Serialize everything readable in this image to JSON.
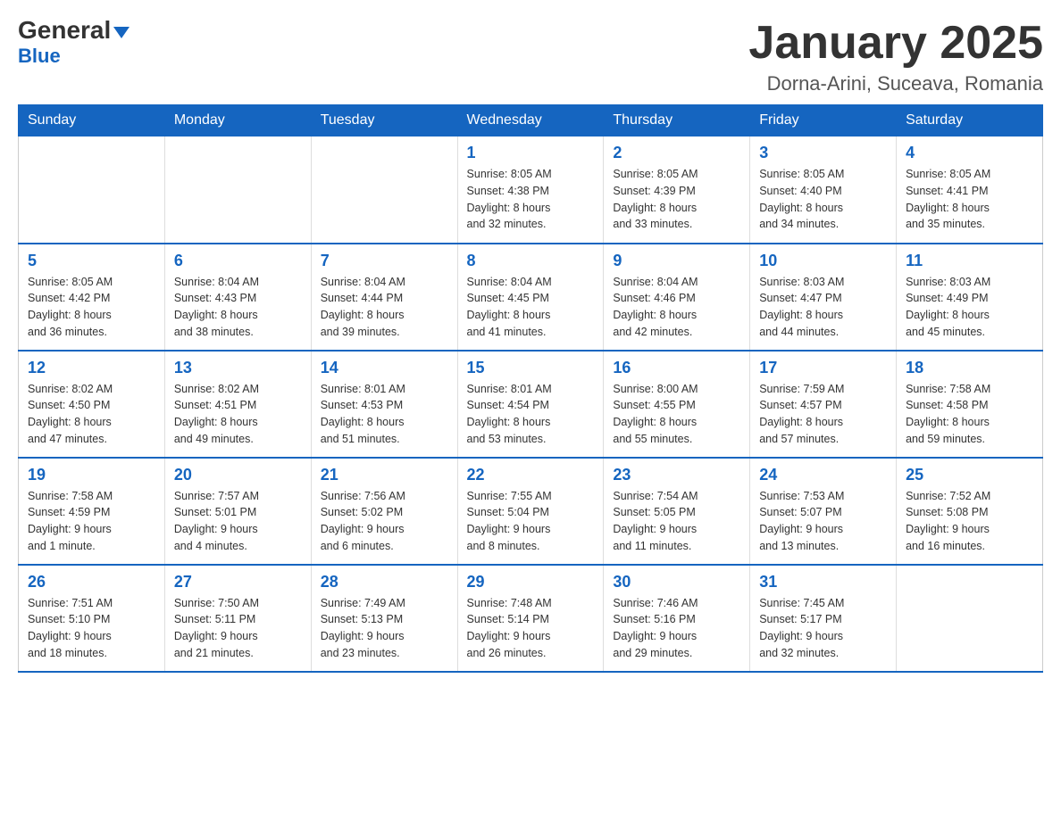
{
  "logo": {
    "text1": "General",
    "text2": "Blue"
  },
  "title": "January 2025",
  "location": "Dorna-Arini, Suceava, Romania",
  "weekdays": [
    "Sunday",
    "Monday",
    "Tuesday",
    "Wednesday",
    "Thursday",
    "Friday",
    "Saturday"
  ],
  "weeks": [
    [
      {
        "day": "",
        "info": ""
      },
      {
        "day": "",
        "info": ""
      },
      {
        "day": "",
        "info": ""
      },
      {
        "day": "1",
        "info": "Sunrise: 8:05 AM\nSunset: 4:38 PM\nDaylight: 8 hours\nand 32 minutes."
      },
      {
        "day": "2",
        "info": "Sunrise: 8:05 AM\nSunset: 4:39 PM\nDaylight: 8 hours\nand 33 minutes."
      },
      {
        "day": "3",
        "info": "Sunrise: 8:05 AM\nSunset: 4:40 PM\nDaylight: 8 hours\nand 34 minutes."
      },
      {
        "day": "4",
        "info": "Sunrise: 8:05 AM\nSunset: 4:41 PM\nDaylight: 8 hours\nand 35 minutes."
      }
    ],
    [
      {
        "day": "5",
        "info": "Sunrise: 8:05 AM\nSunset: 4:42 PM\nDaylight: 8 hours\nand 36 minutes."
      },
      {
        "day": "6",
        "info": "Sunrise: 8:04 AM\nSunset: 4:43 PM\nDaylight: 8 hours\nand 38 minutes."
      },
      {
        "day": "7",
        "info": "Sunrise: 8:04 AM\nSunset: 4:44 PM\nDaylight: 8 hours\nand 39 minutes."
      },
      {
        "day": "8",
        "info": "Sunrise: 8:04 AM\nSunset: 4:45 PM\nDaylight: 8 hours\nand 41 minutes."
      },
      {
        "day": "9",
        "info": "Sunrise: 8:04 AM\nSunset: 4:46 PM\nDaylight: 8 hours\nand 42 minutes."
      },
      {
        "day": "10",
        "info": "Sunrise: 8:03 AM\nSunset: 4:47 PM\nDaylight: 8 hours\nand 44 minutes."
      },
      {
        "day": "11",
        "info": "Sunrise: 8:03 AM\nSunset: 4:49 PM\nDaylight: 8 hours\nand 45 minutes."
      }
    ],
    [
      {
        "day": "12",
        "info": "Sunrise: 8:02 AM\nSunset: 4:50 PM\nDaylight: 8 hours\nand 47 minutes."
      },
      {
        "day": "13",
        "info": "Sunrise: 8:02 AM\nSunset: 4:51 PM\nDaylight: 8 hours\nand 49 minutes."
      },
      {
        "day": "14",
        "info": "Sunrise: 8:01 AM\nSunset: 4:53 PM\nDaylight: 8 hours\nand 51 minutes."
      },
      {
        "day": "15",
        "info": "Sunrise: 8:01 AM\nSunset: 4:54 PM\nDaylight: 8 hours\nand 53 minutes."
      },
      {
        "day": "16",
        "info": "Sunrise: 8:00 AM\nSunset: 4:55 PM\nDaylight: 8 hours\nand 55 minutes."
      },
      {
        "day": "17",
        "info": "Sunrise: 7:59 AM\nSunset: 4:57 PM\nDaylight: 8 hours\nand 57 minutes."
      },
      {
        "day": "18",
        "info": "Sunrise: 7:58 AM\nSunset: 4:58 PM\nDaylight: 8 hours\nand 59 minutes."
      }
    ],
    [
      {
        "day": "19",
        "info": "Sunrise: 7:58 AM\nSunset: 4:59 PM\nDaylight: 9 hours\nand 1 minute."
      },
      {
        "day": "20",
        "info": "Sunrise: 7:57 AM\nSunset: 5:01 PM\nDaylight: 9 hours\nand 4 minutes."
      },
      {
        "day": "21",
        "info": "Sunrise: 7:56 AM\nSunset: 5:02 PM\nDaylight: 9 hours\nand 6 minutes."
      },
      {
        "day": "22",
        "info": "Sunrise: 7:55 AM\nSunset: 5:04 PM\nDaylight: 9 hours\nand 8 minutes."
      },
      {
        "day": "23",
        "info": "Sunrise: 7:54 AM\nSunset: 5:05 PM\nDaylight: 9 hours\nand 11 minutes."
      },
      {
        "day": "24",
        "info": "Sunrise: 7:53 AM\nSunset: 5:07 PM\nDaylight: 9 hours\nand 13 minutes."
      },
      {
        "day": "25",
        "info": "Sunrise: 7:52 AM\nSunset: 5:08 PM\nDaylight: 9 hours\nand 16 minutes."
      }
    ],
    [
      {
        "day": "26",
        "info": "Sunrise: 7:51 AM\nSunset: 5:10 PM\nDaylight: 9 hours\nand 18 minutes."
      },
      {
        "day": "27",
        "info": "Sunrise: 7:50 AM\nSunset: 5:11 PM\nDaylight: 9 hours\nand 21 minutes."
      },
      {
        "day": "28",
        "info": "Sunrise: 7:49 AM\nSunset: 5:13 PM\nDaylight: 9 hours\nand 23 minutes."
      },
      {
        "day": "29",
        "info": "Sunrise: 7:48 AM\nSunset: 5:14 PM\nDaylight: 9 hours\nand 26 minutes."
      },
      {
        "day": "30",
        "info": "Sunrise: 7:46 AM\nSunset: 5:16 PM\nDaylight: 9 hours\nand 29 minutes."
      },
      {
        "day": "31",
        "info": "Sunrise: 7:45 AM\nSunset: 5:17 PM\nDaylight: 9 hours\nand 32 minutes."
      },
      {
        "day": "",
        "info": ""
      }
    ]
  ]
}
